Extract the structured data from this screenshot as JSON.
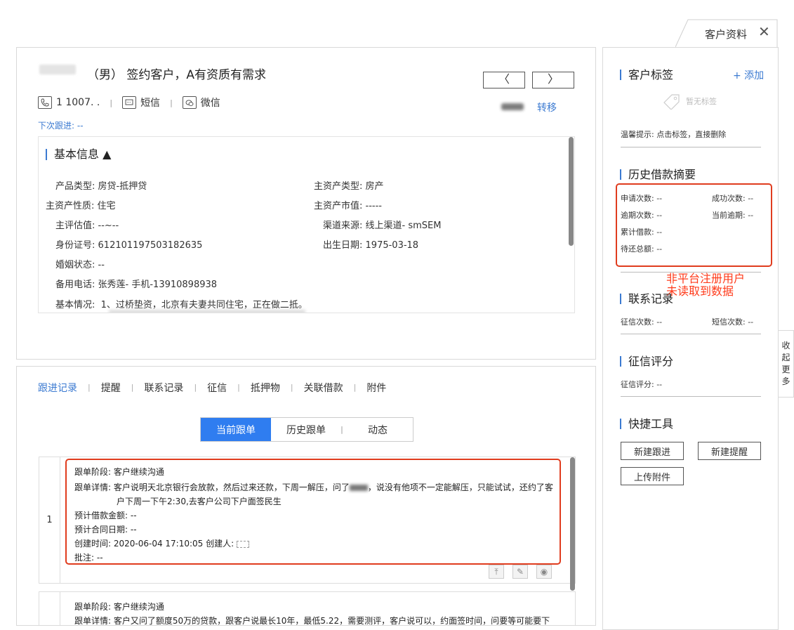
{
  "right_tab": {
    "label": "客户资料",
    "close": "✕"
  },
  "customer": {
    "title": "（男）  签约客户，A有资质有需求",
    "prev": "〈",
    "next": "〉",
    "phone": "1 1007. .",
    "sms": "短信",
    "wechat": "微信",
    "next_follow": "下次跟进: --",
    "transfer": "转移"
  },
  "basic_info": {
    "title": "基本信息 ▲",
    "rows": [
      {
        "k": "产品类型:",
        "v": "房贷-抵押贷"
      },
      {
        "k": "主资产类型:",
        "v": "房产"
      },
      {
        "k": "主资产性质:",
        "v": "住宅"
      },
      {
        "k": "主资产市值:",
        "v": "-----"
      },
      {
        "k": "主评估值:",
        "v": "--~--"
      },
      {
        "k": "渠道来源:",
        "v": "线上渠道- smSEM"
      },
      {
        "k": "身份证号:",
        "v": "612101197503182635"
      },
      {
        "k": "出生日期:",
        "v": "1975-03-18"
      },
      {
        "k": "婚姻状态:",
        "v": "--"
      },
      {
        "k": "备用电话:",
        "v": "张秀莲- 手机-13910898938"
      },
      {
        "k": "基本情况:",
        "v": "1、过桥垫资，北京有夫妻共同住宅，正在做二抵。"
      }
    ]
  },
  "tabs": [
    "跟进记录",
    "提醒",
    "联系记录",
    "征信",
    "抵押物",
    "关联借款",
    "附件"
  ],
  "segments": [
    "当前跟单",
    "历史跟单",
    "动态"
  ],
  "records": [
    {
      "index": "1",
      "stage": "跟单阶段: 客户继续沟通",
      "detail1": "跟单详情: 客户说明天北京银行会放款，然后过来还款，下周一解压，问了",
      "detail1b": "，说没有他项不一定能解压，只能试试，还约了客",
      "detail2": "户下周一下午2:30,去客户公司下户面签民生",
      "amount": "预计借款金额:  --",
      "contract": "预计合同日期: --",
      "created": "创建时间: 2020-06-04 17:10:05 创建人:",
      "remark": "批注: --"
    },
    {
      "stage": "跟单阶段: 客户继续沟通",
      "detail1": "跟单详情: 客户又问了额度50万的贷款，跟客户说最长10年，最低5.22，需要测评，客户说可以，约面签时间，问要等可能要下"
    }
  ],
  "sidebar": {
    "tags_title": "客户标签",
    "tags_add": "+ 添加",
    "no_tags": "暂无标签",
    "tip": "温馨提示: 点击标签，直接删除",
    "history_title": "历史借款摘要",
    "apply_count": "申请次数: --",
    "success_count": "成功次数: --",
    "overdue_count": "逾期次数: --",
    "current_overdue": "当前逾期: --",
    "total_loan": "累计借款: --",
    "pending_total": "待还总额: --",
    "contact_title": "联系记录",
    "credit_count": "征信次数: --",
    "sms_count": "短信次数: --",
    "score_title": "征信评分",
    "score": "征信评分: --",
    "tools_title": "快捷工具",
    "new_follow": "新建跟进",
    "new_remind": "新建提醒",
    "upload": "上传附件"
  },
  "annotation": {
    "line1": "非平台注册用户",
    "line2": "未读取到数据"
  },
  "collapse": [
    "收",
    "起",
    "更",
    "多"
  ],
  "colors": {
    "accent": "#3b7ad1",
    "annotation": "#e03c1e"
  }
}
